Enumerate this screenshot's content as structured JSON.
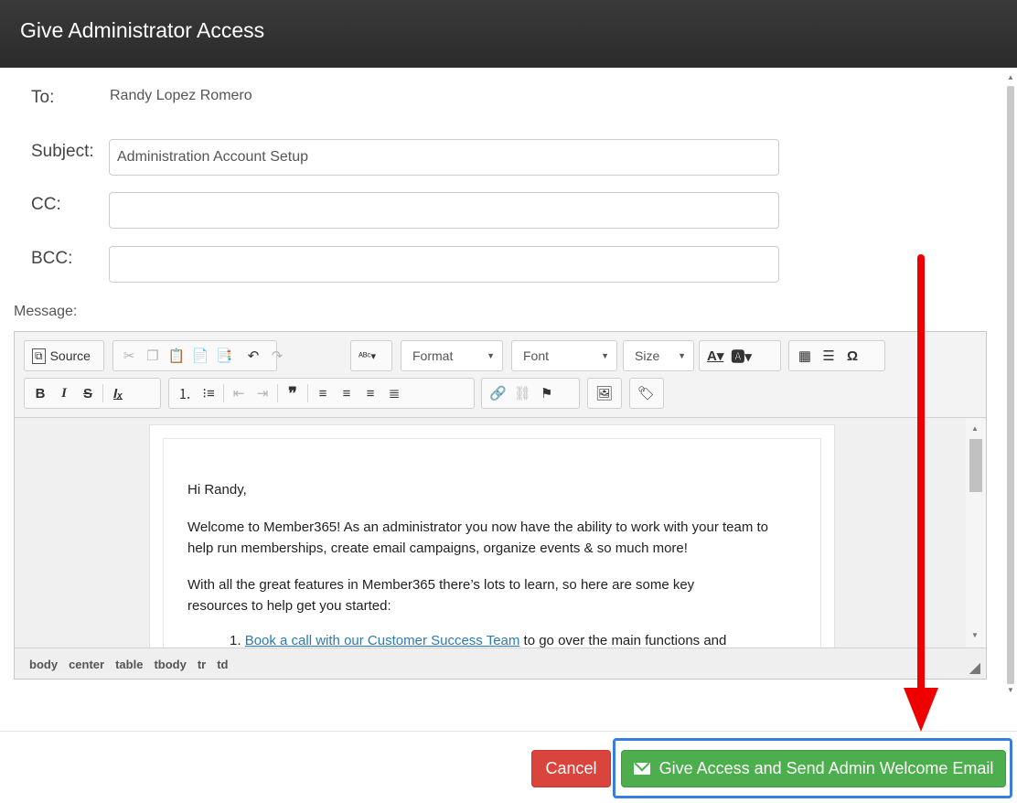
{
  "dialog": {
    "title": "Give Administrator Access"
  },
  "form": {
    "to_label": "To:",
    "to_value": "Randy Lopez Romero",
    "subject_label": "Subject:",
    "subject_value": "Administration Account Setup",
    "cc_label": "CC:",
    "cc_value": "",
    "bcc_label": "BCC:",
    "bcc_value": "",
    "message_label": "Message:"
  },
  "editor": {
    "toolbar": {
      "source_label": "Source",
      "format_label": "Format",
      "font_label": "Font",
      "size_label": "Size"
    },
    "content": {
      "greeting": "Hi Randy,",
      "paragraph1": "Welcome to Member365! As an administrator you now have the ability to work with your team to help run memberships, create email campaigns, organize events & so much more!",
      "paragraph2": "With all the great features in Member365 there’s lots to learn, so here are some key resources to help get you started:",
      "list_item1_number": "1.",
      "list_item1_link": "Book a call with our Customer Success Team",
      "list_item1_rest": " to go over the main functions and"
    },
    "path": [
      "body",
      "center",
      "table",
      "tbody",
      "tr",
      "td"
    ]
  },
  "buttons": {
    "cancel": "Cancel",
    "give_access": "Give Access and Send Admin Welcome Email"
  },
  "colors": {
    "cancel": "#d9443c",
    "primary": "#4cae4c",
    "highlight": "#3b7ddd",
    "annotation_arrow": "#ee0000"
  }
}
